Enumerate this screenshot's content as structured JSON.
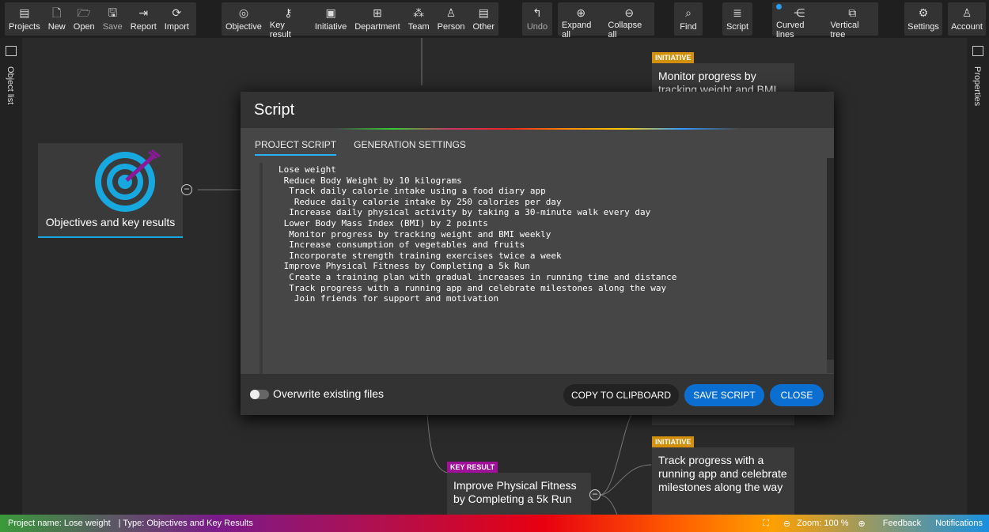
{
  "toolbar": {
    "file": [
      {
        "label": "Projects",
        "icon": "▤"
      },
      {
        "label": "New",
        "icon": "🗋"
      },
      {
        "label": "Open",
        "icon": "🗁"
      },
      {
        "label": "Save",
        "icon": "🖫"
      },
      {
        "label": "Report",
        "icon": "⇥"
      },
      {
        "label": "Import",
        "icon": "⟳"
      }
    ],
    "create": [
      {
        "label": "Objective",
        "icon": "◎"
      },
      {
        "label": "Key result",
        "icon": "⚷"
      },
      {
        "label": "Initiative",
        "icon": "▣"
      },
      {
        "label": "Department",
        "icon": "⊞"
      },
      {
        "label": "Team",
        "icon": "⁂"
      },
      {
        "label": "Person",
        "icon": "♙"
      },
      {
        "label": "Other",
        "icon": "▤"
      }
    ],
    "undo": {
      "label": "Undo",
      "icon": "↰"
    },
    "expand": [
      {
        "label": "Expand all",
        "icon": "⊕"
      },
      {
        "label": "Collapse all",
        "icon": "⊖"
      }
    ],
    "find": {
      "label": "Find",
      "icon": "⌕"
    },
    "script": {
      "label": "Script",
      "icon": "≣"
    },
    "layout": [
      {
        "label": "Curved lines",
        "icon": "⋲"
      },
      {
        "label": "Vertical tree",
        "icon": "⧉"
      }
    ],
    "settings": {
      "label": "Settings",
      "icon": "⚙"
    },
    "account": {
      "label": "Account",
      "icon": "♙"
    }
  },
  "sidebars": {
    "left": "Object list",
    "right": "Properties"
  },
  "canvas": {
    "root": "Objectives and key results",
    "nodes": [
      {
        "badge": "INITIATIVE",
        "text": "Monitor progress by tracking weight and BMI weekly"
      },
      {
        "badge": "INITIATIVE",
        "text": "Track progress with a running app and celebrate milestones along the way"
      },
      {
        "badge": "KEY RESULT",
        "text": "Improve Physical Fitness by Completing a 5k Run"
      }
    ],
    "colors": {
      "initiative": "#d4900a",
      "key_result": "#a0109a",
      "accent": "#18a8e0"
    }
  },
  "modal": {
    "title": "Script",
    "tabs": [
      "PROJECT SCRIPT",
      "GENERATION SETTINGS"
    ],
    "script": "Lose weight\n Reduce Body Weight by 10 kilograms\n  Track daily calorie intake using a food diary app\n   Reduce daily calorie intake by 250 calories per day\n  Increase daily physical activity by taking a 30-minute walk every day\n Lower Body Mass Index (BMI) by 2 points\n  Monitor progress by tracking weight and BMI weekly\n  Increase consumption of vegetables and fruits\n  Incorporate strength training exercises twice a week\n Improve Physical Fitness by Completing a 5k Run\n  Create a training plan with gradual increases in running time and distance\n  Track progress with a running app and celebrate milestones along the way\n   Join friends for support and motivation",
    "overwrite_label": "Overwrite existing files",
    "overwrite": false,
    "copy": "COPY TO CLIPBOARD",
    "save": "SAVE SCRIPT",
    "close": "CLOSE"
  },
  "status": {
    "project": "Project name: Lose weight",
    "type": "| Type: Objectives and Key Results",
    "zoom": "Zoom: 100 %",
    "feedback": "Feedback",
    "notifications": "Notifications"
  }
}
